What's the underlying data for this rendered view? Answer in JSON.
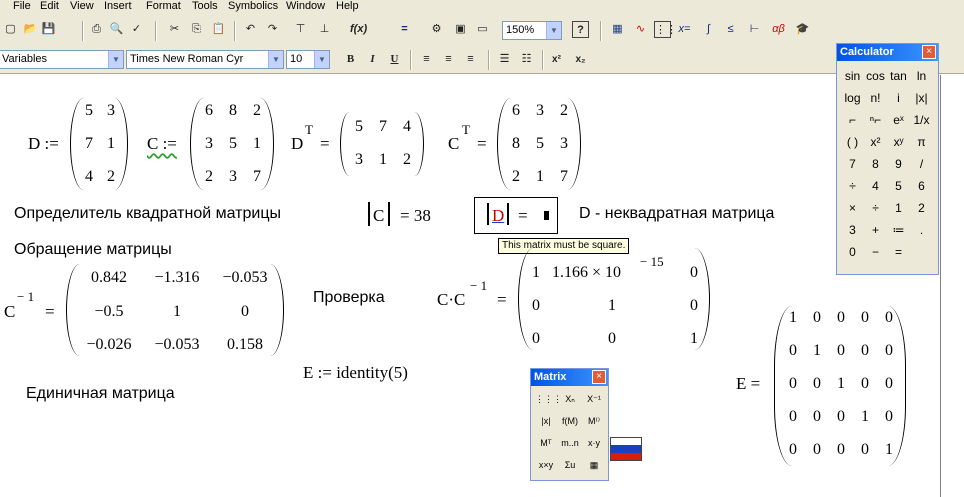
{
  "menu": [
    "File",
    "Edit",
    "View",
    "Insert",
    "Format",
    "Tools",
    "Symbolics",
    "Window",
    "Help"
  ],
  "toolbar": {
    "zoom": "150%",
    "style": "Variables",
    "font": "Times New Roman Cyr",
    "size": "10",
    "bold": "B",
    "italic": "I",
    "underline": "U",
    "sup": "x²",
    "sub": "x₂"
  },
  "doc": {
    "D_def": "D :=",
    "D": [
      [
        "5",
        "3"
      ],
      [
        "7",
        "1"
      ],
      [
        "4",
        "2"
      ]
    ],
    "C_def": "C :=",
    "C": [
      [
        "6",
        "8",
        "2"
      ],
      [
        "3",
        "5",
        "1"
      ],
      [
        "2",
        "3",
        "7"
      ]
    ],
    "DT_def": "D",
    "DT_sup": "T",
    "DT_eq": "=",
    "DT": [
      [
        "5",
        "7",
        "4"
      ],
      [
        "3",
        "1",
        "2"
      ]
    ],
    "CT_def": "C",
    "CT_sup": "T",
    "CT_eq": "=",
    "CT": [
      [
        "6",
        "3",
        "2"
      ],
      [
        "8",
        "5",
        "3"
      ],
      [
        "2",
        "1",
        "7"
      ]
    ],
    "det_label": "Определитель квадратной матрицы",
    "detC_var": "C",
    "detC_val": "= 38",
    "detD_var": "D",
    "detD_eq": "=",
    "nonsquare_label": "D - неквадратная матрица",
    "tooltip": "This matrix must be square.",
    "inv_label": "Обращение  матрицы",
    "Cinv_def": "C",
    "Cinv_sup": "− 1",
    "Cinv_eq": "=",
    "Cinv": [
      [
        "0.842",
        "−1.316",
        "−0.053"
      ],
      [
        "−0.5",
        "1",
        "0"
      ],
      [
        "−0.026",
        "−0.053",
        "0.158"
      ]
    ],
    "check_label": "Проверка",
    "check_def": "C·C",
    "check_sup": "− 1",
    "check_eq": "=",
    "check": [
      [
        "1",
        "1.166 × 10",
        "0"
      ],
      [
        "0",
        "1",
        "0"
      ],
      [
        "0",
        "0",
        "1"
      ]
    ],
    "check_exp": "− 15",
    "E_def": "E := identity(5)",
    "identity_label": "Единичная матрица",
    "E_eq": "E =",
    "E": [
      [
        "1",
        "0",
        "0",
        "0",
        "0"
      ],
      [
        "0",
        "1",
        "0",
        "0",
        "0"
      ],
      [
        "0",
        "0",
        "1",
        "0",
        "0"
      ],
      [
        "0",
        "0",
        "0",
        "1",
        "0"
      ],
      [
        "0",
        "0",
        "0",
        "0",
        "1"
      ]
    ]
  },
  "calculator": {
    "title": "Calculator",
    "close": "×",
    "buttons": [
      "sin",
      "cos",
      "tan",
      "ln",
      "log",
      "n!",
      "i",
      "|x|",
      "⌐",
      "ⁿ⌐",
      "eˣ",
      "1/x",
      "( )",
      "x²",
      "xʸ",
      "π",
      "7",
      "8",
      "9",
      "/",
      "÷",
      "4",
      "5",
      "6",
      "×",
      "÷",
      "1",
      "2",
      "3",
      "+",
      "≔",
      ".",
      "0",
      "−",
      "="
    ]
  },
  "matrix_panel": {
    "title": "Matrix",
    "close": "×",
    "buttons": [
      "⋮⋮⋮",
      "Xₙ",
      "X⁻¹",
      "|x|",
      "f(M)",
      "M⁽⁾",
      "Mᵀ",
      "m..n",
      "x·y",
      "x×y",
      "Σu",
      "▦"
    ]
  }
}
